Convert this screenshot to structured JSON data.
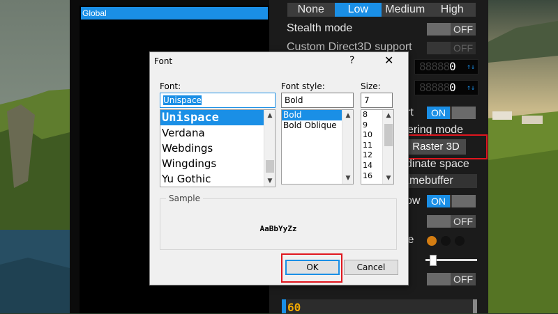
{
  "profiles": {
    "selected": "Global"
  },
  "settings": {
    "detail_levels": [
      "None",
      "Low",
      "Medium",
      "High"
    ],
    "detail_active_index": 1,
    "stealth_mode": {
      "label": "Stealth mode",
      "state": "OFF"
    },
    "custom_d3d": {
      "label": "Custom Direct3D support",
      "state": "OFF"
    },
    "digit_value_1": "0",
    "digit_value_2": "0",
    "support_fragment": {
      "label": "ort",
      "state": "ON"
    },
    "rendering_mode": {
      "label_fragment": "ering mode",
      "value": "Raster 3D"
    },
    "coordinate_space_fragment": "dinate space",
    "framebuffer_fragment": "amebuffer",
    "shadow_fragment": {
      "label": "ow",
      "state": "ON"
    },
    "unlabeled_toggle": {
      "state": "OFF"
    },
    "palette_fragment": "te",
    "palette_colors": [
      "#d47d12",
      "#111111",
      "#111111"
    ],
    "bottom_toggle": {
      "state": "OFF"
    },
    "graph_value": "60"
  },
  "dialog": {
    "title": "Font",
    "help_glyph": "?",
    "close_glyph": "✕",
    "font_label": "Font:",
    "font_value": "Unispace",
    "font_list": [
      "Unispace",
      "Verdana",
      "Webdings",
      "Wingdings",
      "Yu Gothic"
    ],
    "font_selected": "Unispace",
    "style_label": "Font style:",
    "style_value": "Bold",
    "style_list": [
      "Bold",
      "Bold Oblique"
    ],
    "style_selected": "Bold",
    "size_label": "Size:",
    "size_value": "7",
    "size_list": [
      "8",
      "9",
      "10",
      "11",
      "12",
      "14",
      "16"
    ],
    "sample_label": "Sample",
    "sample_text": "AaBbYyZz",
    "ok_label": "OK",
    "cancel_label": "Cancel"
  },
  "colors": {
    "accent": "#1a8fe6",
    "highlight_red": "#e0161e",
    "graph_value_color": "#f2a800"
  }
}
